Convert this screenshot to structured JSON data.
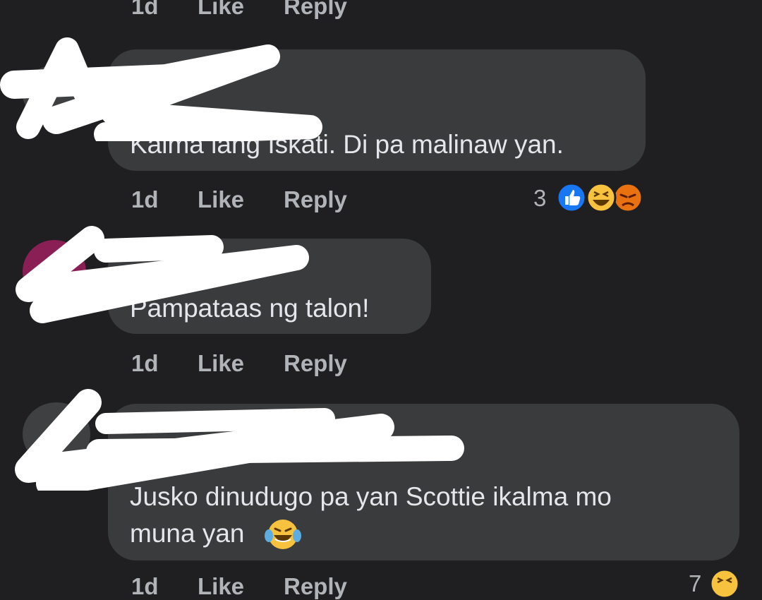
{
  "actions": {
    "time": "1d",
    "like": "Like",
    "reply": "Reply"
  },
  "comments": [
    {
      "text": "Kalma lang Iskati. Di pa malinaw yan.",
      "reaction_count": "3",
      "reactions": [
        "like-reaction-icon",
        "haha-reaction-icon",
        "angry-reaction-icon"
      ]
    },
    {
      "text": "Pampataas ng talon!"
    },
    {
      "text_line1": "Jusko dinudugo pa yan Scottie ikalma mo",
      "text_line2": "muna yan",
      "emoji": "crying-laughing-emoji",
      "reaction_count": "7",
      "reactions": [
        "haha-reaction-icon"
      ]
    }
  ],
  "colors": {
    "background": "#1f1f21",
    "bubble": "#3a3b3c",
    "text": "#e4e6eb",
    "secondary": "#b0b3b8",
    "like_blue": "#1877f2",
    "haha_yellow": "#f7c23d",
    "angry_orange": "#e9710f"
  }
}
